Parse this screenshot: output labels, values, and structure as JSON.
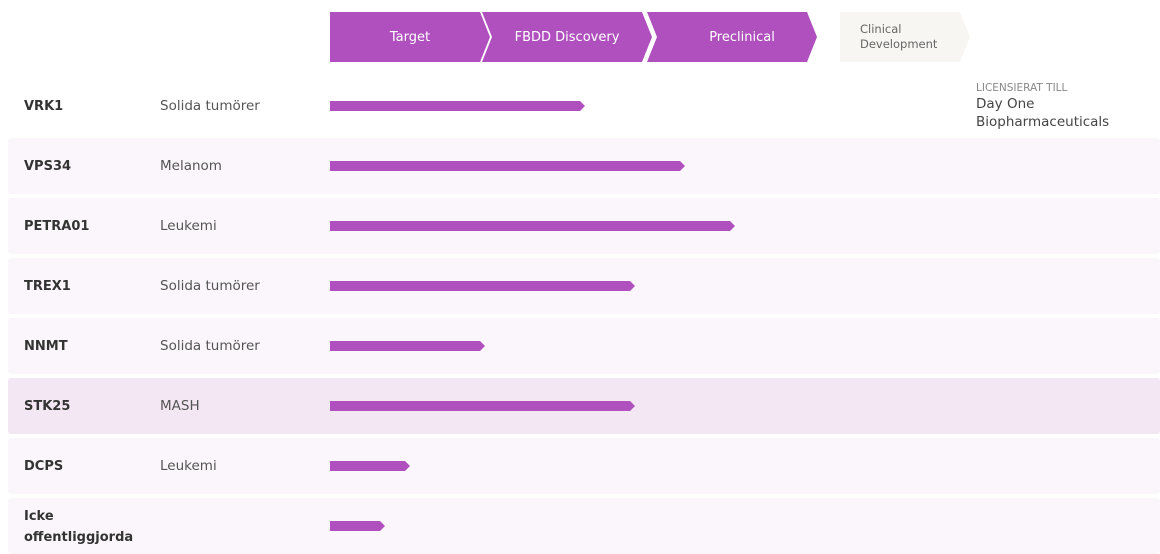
{
  "colors": {
    "accent": "#b050be",
    "stage_inactive_bg": "#f8f6f2",
    "row_shade": "#fbf6fb",
    "row_highlight": "#f3e7f3"
  },
  "stages": [
    {
      "label": "Target",
      "active": true
    },
    {
      "label": "FBDD Discovery",
      "active": true
    },
    {
      "label": "Preclinical",
      "active": true
    },
    {
      "label_line1": "Clinical",
      "label_line2": "Development",
      "active": false
    }
  ],
  "license": {
    "label": "LICENSIERAT TILL",
    "name_line1": "Day One",
    "name_line2": "Biopharmaceuticals"
  },
  "programs": [
    {
      "target": "VRK1",
      "indication": "Solida tumörer",
      "progress": 0.386
    },
    {
      "target": "VPS34",
      "indication": "Melanom",
      "progress": 0.538
    },
    {
      "target": "PETRA01",
      "indication": "Leukemi",
      "progress": 0.614
    },
    {
      "target": "TREX1",
      "indication": "Solida tumörer",
      "progress": 0.462
    },
    {
      "target": "NNMT",
      "indication": "Solida tumörer",
      "progress": 0.235
    },
    {
      "target": "STK25",
      "indication": "MASH",
      "progress": 0.462
    },
    {
      "target": "DCPS",
      "indication": "Leukemi",
      "progress": 0.121
    },
    {
      "target_line1": "Icke",
      "target_line2": "offentliggjorda",
      "indication": "",
      "progress": 0.083
    }
  ]
}
